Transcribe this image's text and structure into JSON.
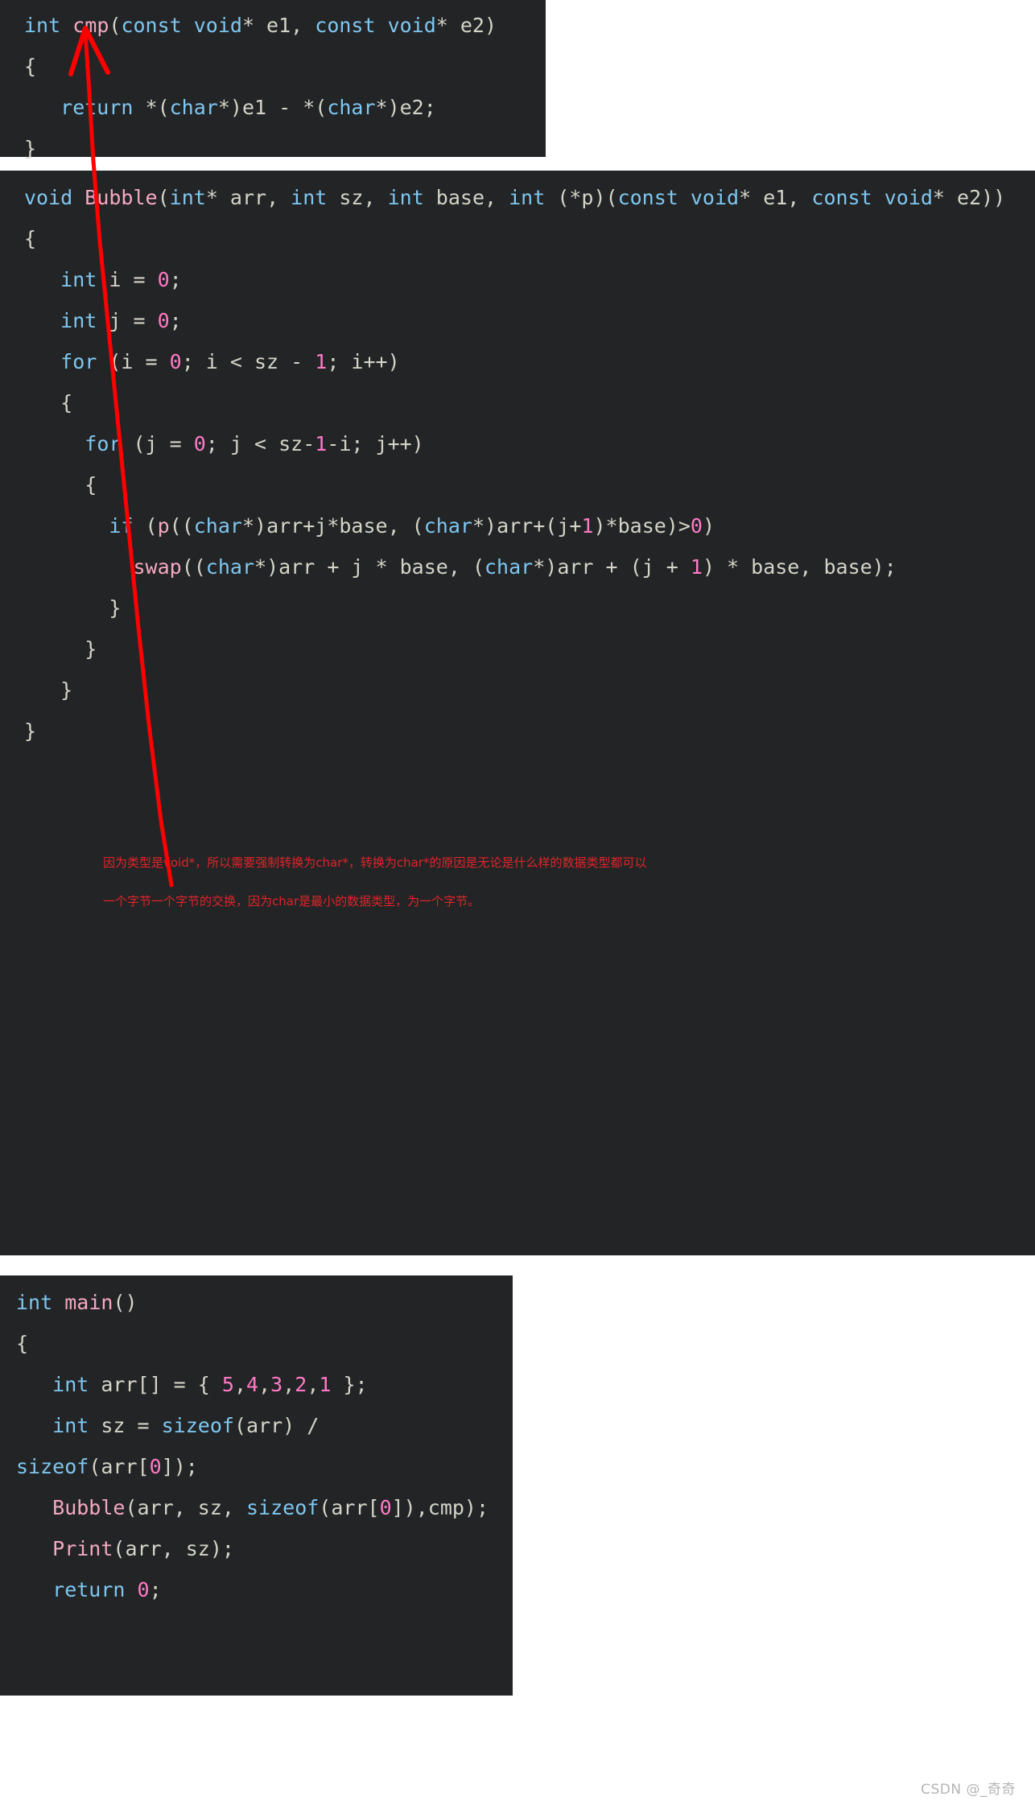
{
  "theme": {
    "code_background": "#232426",
    "page_background": "#ffffff",
    "keyword_color": "#7ec7f0",
    "function_color": "#f5a9c0",
    "number_color": "#ff7ac6",
    "plain_color": "#d4d4c8",
    "annotation_color": "#e0242a",
    "arrow_color": "#ff0000",
    "watermark_color": "#b4b4b4"
  },
  "blocks": {
    "cmp": {
      "name": "cmp-function-code-block",
      "lines": [
        [
          {
            "t": "int ",
            "c": "kw"
          },
          {
            "t": "cmp",
            "c": "fn"
          },
          {
            "t": "(",
            "c": "pl"
          },
          {
            "t": "const void",
            "c": "kw"
          },
          {
            "t": "* e1, ",
            "c": "pl"
          },
          {
            "t": "const void",
            "c": "kw"
          },
          {
            "t": "* e2)",
            "c": "pl"
          }
        ],
        [
          {
            "t": "{",
            "c": "pl"
          }
        ],
        [
          {
            "t": "   ",
            "c": "pl"
          },
          {
            "t": "return",
            "c": "kw"
          },
          {
            "t": " *(",
            "c": "pl"
          },
          {
            "t": "char",
            "c": "kw"
          },
          {
            "t": "*)e1 - *(",
            "c": "pl"
          },
          {
            "t": "char",
            "c": "kw"
          },
          {
            "t": "*)e2;",
            "c": "pl"
          }
        ],
        [
          {
            "t": "}",
            "c": "pl"
          }
        ]
      ]
    },
    "bubble": {
      "name": "bubble-function-code-block",
      "lines": [
        [
          {
            "t": "void",
            "c": "kw"
          },
          {
            "t": " ",
            "c": "pl"
          },
          {
            "t": "Bubble",
            "c": "fn"
          },
          {
            "t": "(",
            "c": "pl"
          },
          {
            "t": "int",
            "c": "kw"
          },
          {
            "t": "* arr, ",
            "c": "pl"
          },
          {
            "t": "int",
            "c": "kw"
          },
          {
            "t": " sz, ",
            "c": "pl"
          },
          {
            "t": "int",
            "c": "kw"
          },
          {
            "t": " base, ",
            "c": "pl"
          },
          {
            "t": "int",
            "c": "kw"
          },
          {
            "t": " (*p)(",
            "c": "pl"
          },
          {
            "t": "const void",
            "c": "kw"
          },
          {
            "t": "* e1, ",
            "c": "pl"
          },
          {
            "t": "const void",
            "c": "kw"
          },
          {
            "t": "* e2))",
            "c": "pl"
          }
        ],
        [
          {
            "t": "{",
            "c": "pl"
          }
        ],
        [
          {
            "t": "   ",
            "c": "pl"
          },
          {
            "t": "int",
            "c": "kw"
          },
          {
            "t": " i = ",
            "c": "pl"
          },
          {
            "t": "0",
            "c": "num"
          },
          {
            "t": ";",
            "c": "pl"
          }
        ],
        [
          {
            "t": "   ",
            "c": "pl"
          },
          {
            "t": "int",
            "c": "kw"
          },
          {
            "t": " j = ",
            "c": "pl"
          },
          {
            "t": "0",
            "c": "num"
          },
          {
            "t": ";",
            "c": "pl"
          }
        ],
        [
          {
            "t": "   ",
            "c": "pl"
          },
          {
            "t": "for",
            "c": "kw"
          },
          {
            "t": " (i = ",
            "c": "pl"
          },
          {
            "t": "0",
            "c": "num"
          },
          {
            "t": "; i < sz - ",
            "c": "pl"
          },
          {
            "t": "1",
            "c": "num"
          },
          {
            "t": "; i++)",
            "c": "pl"
          }
        ],
        [
          {
            "t": "   {",
            "c": "pl"
          }
        ],
        [
          {
            "t": "     ",
            "c": "pl"
          },
          {
            "t": "for",
            "c": "kw"
          },
          {
            "t": " (j = ",
            "c": "pl"
          },
          {
            "t": "0",
            "c": "num"
          },
          {
            "t": "; j < sz-",
            "c": "pl"
          },
          {
            "t": "1",
            "c": "num"
          },
          {
            "t": "-i; j++)",
            "c": "pl"
          }
        ],
        [
          {
            "t": "     {",
            "c": "pl"
          }
        ],
        [
          {
            "t": "       ",
            "c": "pl"
          },
          {
            "t": "if",
            "c": "kw"
          },
          {
            "t": " (",
            "c": "pl"
          },
          {
            "t": "p",
            "c": "fn"
          },
          {
            "t": "((",
            "c": "pl"
          },
          {
            "t": "char",
            "c": "kw"
          },
          {
            "t": "*)arr+j*base, (",
            "c": "pl"
          },
          {
            "t": "char",
            "c": "kw"
          },
          {
            "t": "*)arr+(j+",
            "c": "pl"
          },
          {
            "t": "1",
            "c": "num"
          },
          {
            "t": ")*base)>",
            "c": "pl"
          },
          {
            "t": "0",
            "c": "num"
          },
          {
            "t": ")",
            "c": "pl"
          }
        ],
        [
          {
            "t": "         ",
            "c": "pl"
          },
          {
            "t": "swap",
            "c": "fn"
          },
          {
            "t": "((",
            "c": "pl"
          },
          {
            "t": "char",
            "c": "kw"
          },
          {
            "t": "*)arr + j * base, (",
            "c": "pl"
          },
          {
            "t": "char",
            "c": "kw"
          },
          {
            "t": "*)arr + (j + ",
            "c": "pl"
          },
          {
            "t": "1",
            "c": "num"
          },
          {
            "t": ") * base, base);",
            "c": "pl"
          }
        ],
        [
          {
            "t": "       }",
            "c": "pl"
          }
        ],
        [
          {
            "t": "     }",
            "c": "pl"
          }
        ],
        [
          {
            "t": "   }",
            "c": "pl"
          }
        ],
        [
          {
            "t": "}",
            "c": "pl"
          }
        ]
      ]
    },
    "main": {
      "name": "main-function-code-block",
      "lines": [
        [
          {
            "t": "int",
            "c": "kw"
          },
          {
            "t": " ",
            "c": "pl"
          },
          {
            "t": "main",
            "c": "fn"
          },
          {
            "t": "()",
            "c": "pl"
          }
        ],
        [
          {
            "t": "{",
            "c": "pl"
          }
        ],
        [
          {
            "t": "   ",
            "c": "pl"
          },
          {
            "t": "int",
            "c": "kw"
          },
          {
            "t": " arr[] = { ",
            "c": "pl"
          },
          {
            "t": "5",
            "c": "num"
          },
          {
            "t": ",",
            "c": "pl"
          },
          {
            "t": "4",
            "c": "num"
          },
          {
            "t": ",",
            "c": "pl"
          },
          {
            "t": "3",
            "c": "num"
          },
          {
            "t": ",",
            "c": "pl"
          },
          {
            "t": "2",
            "c": "num"
          },
          {
            "t": ",",
            "c": "pl"
          },
          {
            "t": "1",
            "c": "num"
          },
          {
            "t": " };",
            "c": "pl"
          }
        ],
        [
          {
            "t": "   ",
            "c": "pl"
          },
          {
            "t": "int",
            "c": "kw"
          },
          {
            "t": " sz = ",
            "c": "pl"
          },
          {
            "t": "sizeof",
            "c": "kw"
          },
          {
            "t": "(arr) / ",
            "c": "pl"
          },
          {
            "t": "sizeof",
            "c": "kw"
          },
          {
            "t": "(arr[",
            "c": "pl"
          },
          {
            "t": "0",
            "c": "num"
          },
          {
            "t": "]);",
            "c": "pl"
          }
        ],
        [
          {
            "t": "   ",
            "c": "pl"
          },
          {
            "t": "Bubble",
            "c": "fn"
          },
          {
            "t": "(arr, sz, ",
            "c": "pl"
          },
          {
            "t": "sizeof",
            "c": "kw"
          },
          {
            "t": "(arr[",
            "c": "pl"
          },
          {
            "t": "0",
            "c": "num"
          },
          {
            "t": "]),cmp);",
            "c": "pl"
          }
        ],
        [
          {
            "t": "   ",
            "c": "pl"
          },
          {
            "t": "Print",
            "c": "fn"
          },
          {
            "t": "(arr, sz);",
            "c": "pl"
          }
        ],
        [
          {
            "t": "   ",
            "c": "pl"
          },
          {
            "t": "return",
            "c": "kw"
          },
          {
            "t": " ",
            "c": "pl"
          },
          {
            "t": "0",
            "c": "num"
          },
          {
            "t": ";",
            "c": "pl"
          }
        ]
      ]
    }
  },
  "annotation": {
    "line1": "因为类型是void*，所以需要强制转换为char*，转换为char*的原因是无论是什么样的数据类型都可以",
    "line2": "一个字节一个字节的交换，因为char是最小的数据类型，为一个字节。"
  },
  "watermark": {
    "text": "CSDN @_奇奇"
  }
}
